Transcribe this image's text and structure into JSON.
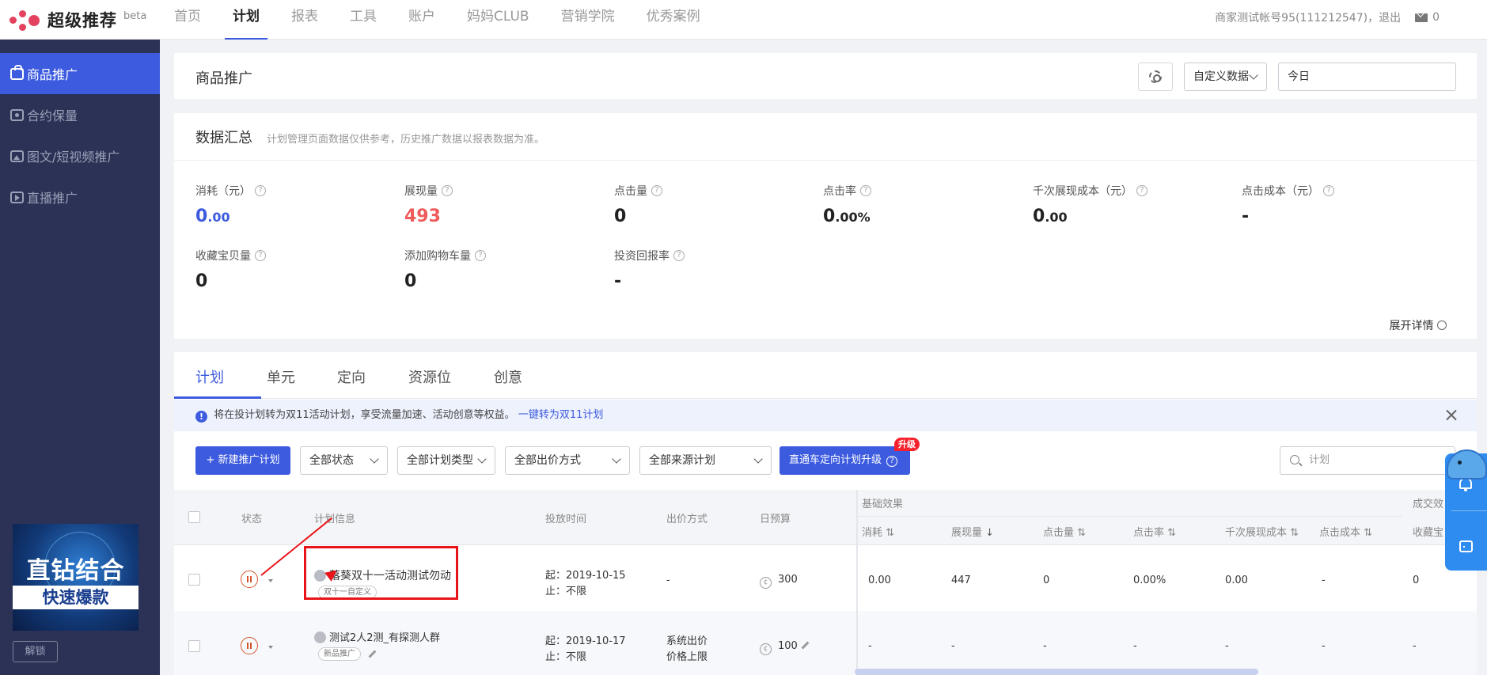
{
  "topbar": {
    "logo_text": "超级推荐",
    "beta": "beta",
    "nav": [
      "首页",
      "计划",
      "报表",
      "工具",
      "账户",
      "妈妈CLUB",
      "营销学院",
      "优秀案例"
    ],
    "active_nav": "计划",
    "account_text": "商家测试帐号95(111212547)，退出",
    "mail_count": "0"
  },
  "sidebar": {
    "items": [
      {
        "label": "商品推广",
        "icon": "bag-icon",
        "active": true
      },
      {
        "label": "合约保量",
        "icon": "lock-icon",
        "active": false
      },
      {
        "label": "图文/短视频推广",
        "icon": "image-icon",
        "active": false
      },
      {
        "label": "直播推广",
        "icon": "play-icon",
        "active": false
      }
    ],
    "promo": {
      "line1": "直钻结合",
      "line2": "快速爆款"
    },
    "unlock_label": "解锁"
  },
  "header": {
    "title": "商品推广",
    "data_select": "自定义数据",
    "date_value": "今日"
  },
  "summary": {
    "title": "数据汇总",
    "note": "计划管理页面数据仅供参考，历史推广数据以报表数据为准。",
    "metrics": [
      {
        "label": "消耗（元）",
        "int": "0",
        "dec": ".00",
        "color": "blue"
      },
      {
        "label": "展现量",
        "int": "493",
        "dec": "",
        "color": "red"
      },
      {
        "label": "点击量",
        "int": "0",
        "dec": "",
        "color": "default"
      },
      {
        "label": "点击率",
        "int": "0",
        "dec": ".00%",
        "color": "default"
      },
      {
        "label": "千次展现成本（元）",
        "int": "0",
        "dec": ".00",
        "color": "default"
      },
      {
        "label": "点击成本（元）",
        "int": "-",
        "dec": "",
        "color": "default"
      },
      {
        "label": "收藏宝贝量",
        "int": "0",
        "dec": "",
        "color": "default"
      },
      {
        "label": "添加购物车量",
        "int": "0",
        "dec": "",
        "color": "default"
      },
      {
        "label": "投资回报率",
        "int": "-",
        "dec": "",
        "color": "default"
      }
    ],
    "expand_label": "展开详情"
  },
  "plan_table": {
    "tabs": [
      "计划",
      "单元",
      "定向",
      "资源位",
      "创意"
    ],
    "notice_text": "将在投计划转为双11活动计划，享受流量加速、活动创意等权益。",
    "notice_link": "一键转为双11计划",
    "new_plan_button": "+ 新建推广计划",
    "filters": [
      "全部状态",
      "全部计划类型",
      "全部出价方式",
      "全部来源计划"
    ],
    "upgrade_button": "直通车定向计划升级",
    "upgrade_badge": "升级",
    "search_placeholder": "计划",
    "headers": {
      "status": "状态",
      "info": "计划信息",
      "time": "投放时间",
      "bid": "出价方式",
      "budget": "日预算",
      "group_basic": "基础效果",
      "group_deal": "成交效",
      "cost": "消耗",
      "impressions": "展现量",
      "clicks": "点击量",
      "ctr": "点击率",
      "cpm": "千次展现成本",
      "cpc": "点击成本",
      "fav": "收藏宝"
    },
    "rows": [
      {
        "name": "落葵双十一活动测试勿动",
        "tag": "双十一自定义",
        "start": "起：2019-10-15",
        "end": "止：不限",
        "bid": "-",
        "bid2": "",
        "budget": "300",
        "cost": "0.00",
        "impressions": "447",
        "clicks": "0",
        "ctr": "0.00%",
        "cpm": "0.00",
        "cpc": "-",
        "fav": "0"
      },
      {
        "name": "测试2人2测_有探测人群",
        "tag": "新品推广",
        "start": "起：2019-10-17",
        "end": "止：不限",
        "bid": "系统出价",
        "bid2": "价格上限",
        "budget": "100",
        "cost": "-",
        "impressions": "-",
        "clicks": "-",
        "ctr": "-",
        "cpm": "-",
        "cpc": "-",
        "fav": "-"
      }
    ]
  },
  "colors": {
    "primary": "#3d5bde",
    "sidebar_bg": "#2b3256",
    "highlight_red": "#e8141a",
    "metric_red": "#ef5a5a"
  }
}
